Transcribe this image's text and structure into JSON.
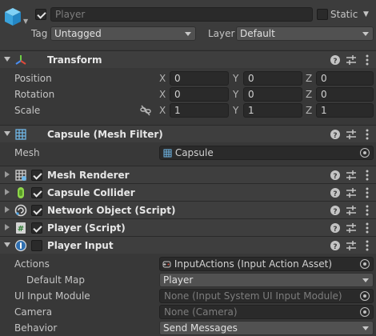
{
  "gameobject": {
    "name": "Player",
    "active": true,
    "static_label": "Static",
    "static": false,
    "tag_label": "Tag",
    "tag": "Untagged",
    "layer_label": "Layer",
    "layer": "Default"
  },
  "transform": {
    "title": "Transform",
    "position": {
      "label": "Position",
      "x": "0",
      "y": "0",
      "z": "0"
    },
    "rotation": {
      "label": "Rotation",
      "x": "0",
      "y": "0",
      "z": "0"
    },
    "scale": {
      "label": "Scale",
      "x": "1",
      "y": "1",
      "z": "1"
    },
    "axes": {
      "x": "X",
      "y": "Y",
      "z": "Z"
    }
  },
  "mesh_filter": {
    "title": "Capsule (Mesh Filter)",
    "mesh_label": "Mesh",
    "mesh_value": "Capsule"
  },
  "collapsed_components": [
    {
      "title": "Mesh Renderer",
      "enabled": true,
      "icon": "mesh-renderer-icon"
    },
    {
      "title": "Capsule Collider",
      "enabled": true,
      "icon": "capsule-collider-icon"
    },
    {
      "title": "Network Object (Script)",
      "enabled": true,
      "icon": "network-object-icon"
    },
    {
      "title": "Player (Script)",
      "enabled": true,
      "icon": "script-icon"
    }
  ],
  "player_input": {
    "title": "Player Input",
    "enabled": false,
    "actions_label": "Actions",
    "actions_value": "InputActions (Input Action Asset)",
    "default_map_label": "Default Map",
    "default_map_value": "Player",
    "ui_module_label": "UI Input Module",
    "ui_module_value": "None (Input System UI Input Module)",
    "camera_label": "Camera",
    "camera_value": "None (Camera)",
    "behavior_label": "Behavior",
    "behavior_value": "Send Messages"
  },
  "colors": {
    "background": "#383838",
    "header": "#3e3e3e",
    "field": "#2a2a2a",
    "dropdown": "#515151",
    "gameobject_icon": "#4fb3e8"
  }
}
